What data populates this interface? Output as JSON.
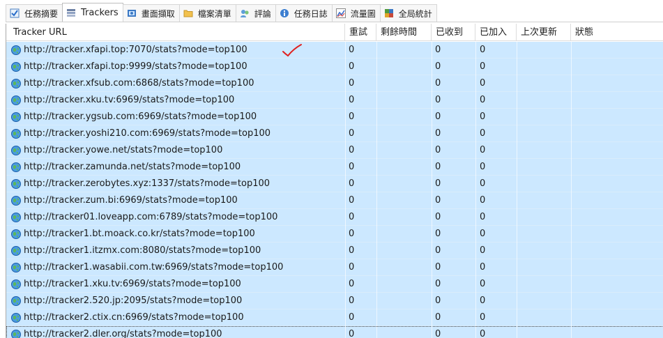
{
  "tabs": [
    {
      "label": "任務摘要",
      "icon": "summary-icon",
      "active": false
    },
    {
      "label": "Trackers",
      "icon": "trackers-icon",
      "active": true
    },
    {
      "label": "畫面擷取",
      "icon": "screenshot-icon",
      "active": false
    },
    {
      "label": "檔案清單",
      "icon": "folder-icon",
      "active": false
    },
    {
      "label": "評論",
      "icon": "comments-icon",
      "active": false
    },
    {
      "label": "任務日誌",
      "icon": "log-icon",
      "active": false
    },
    {
      "label": "流量圖",
      "icon": "chart-icon",
      "active": false
    },
    {
      "label": "全局統計",
      "icon": "stats-icon",
      "active": false
    }
  ],
  "columns": {
    "url": "Tracker URL",
    "retry": "重試",
    "remaining": "剩餘時間",
    "received": "已收到",
    "joined": "已加入",
    "last_update": "上次更新",
    "status": "狀態"
  },
  "rows": [
    {
      "url": "http://tracker.xfapi.top:7070/stats?mode=top100",
      "retry": "0",
      "received": "0",
      "joined": "0"
    },
    {
      "url": "http://tracker.xfapi.top:9999/stats?mode=top100",
      "retry": "0",
      "received": "0",
      "joined": "0"
    },
    {
      "url": "http://tracker.xfsub.com:6868/stats?mode=top100",
      "retry": "0",
      "received": "0",
      "joined": "0"
    },
    {
      "url": "http://tracker.xku.tv:6969/stats?mode=top100",
      "retry": "0",
      "received": "0",
      "joined": "0"
    },
    {
      "url": "http://tracker.ygsub.com:6969/stats?mode=top100",
      "retry": "0",
      "received": "0",
      "joined": "0"
    },
    {
      "url": "http://tracker.yoshi210.com:6969/stats?mode=top100",
      "retry": "0",
      "received": "0",
      "joined": "0"
    },
    {
      "url": "http://tracker.yowe.net/stats?mode=top100",
      "retry": "0",
      "received": "0",
      "joined": "0"
    },
    {
      "url": "http://tracker.zamunda.net/stats?mode=top100",
      "retry": "0",
      "received": "0",
      "joined": "0"
    },
    {
      "url": "http://tracker.zerobytes.xyz:1337/stats?mode=top100",
      "retry": "0",
      "received": "0",
      "joined": "0"
    },
    {
      "url": "http://tracker.zum.bi:6969/stats?mode=top100",
      "retry": "0",
      "received": "0",
      "joined": "0"
    },
    {
      "url": "http://tracker01.loveapp.com:6789/stats?mode=top100",
      "retry": "0",
      "received": "0",
      "joined": "0"
    },
    {
      "url": "http://tracker1.bt.moack.co.kr/stats?mode=top100",
      "retry": "0",
      "received": "0",
      "joined": "0"
    },
    {
      "url": "http://tracker1.itzmx.com:8080/stats?mode=top100",
      "retry": "0",
      "received": "0",
      "joined": "0"
    },
    {
      "url": "http://tracker1.wasabii.com.tw:6969/stats?mode=top100",
      "retry": "0",
      "received": "0",
      "joined": "0"
    },
    {
      "url": "http://tracker1.xku.tv:6969/stats?mode=top100",
      "retry": "0",
      "received": "0",
      "joined": "0"
    },
    {
      "url": "http://tracker2.520.jp:2095/stats?mode=top100",
      "retry": "0",
      "received": "0",
      "joined": "0"
    },
    {
      "url": "http://tracker2.ctix.cn:6969/stats?mode=top100",
      "retry": "0",
      "received": "0",
      "joined": "0"
    },
    {
      "url": "http://tracker2.dler.org/stats?mode=top100",
      "retry": "0",
      "received": "0",
      "joined": "0"
    }
  ],
  "colors": {
    "selection": "#cce8ff",
    "checkmark": "#e0201e"
  },
  "icons": {
    "row": "globe-icon",
    "annotation": "checkmark-annotation"
  }
}
